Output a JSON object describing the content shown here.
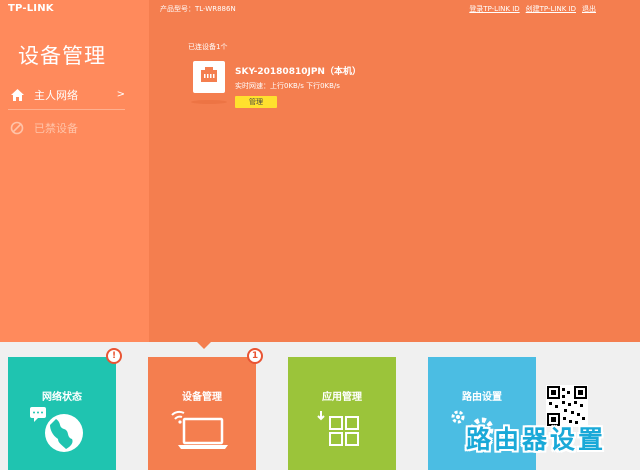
{
  "header": {
    "logo": "TP-LINK",
    "product_label": "产品型号：TL-WR886N",
    "links": [
      "登录TP-LINK ID",
      "创建TP-LINK ID",
      "退出"
    ]
  },
  "sidebar": {
    "title": "设备管理",
    "items": [
      {
        "label": "主人网络",
        "arrow": ">",
        "icon": "home-icon"
      },
      {
        "label": "已禁设备",
        "icon": "blocked-icon"
      }
    ]
  },
  "main": {
    "connected_label": "已连设备1个",
    "device": {
      "name": "SKY-20180810JPN（本机）",
      "speed": "实时网速：上行0KB/s  下行0KB/s",
      "manage_label": "管理",
      "icon": "ethernet-port-icon"
    }
  },
  "tiles": [
    {
      "label": "网络状态",
      "badge": "!",
      "icon": "globe-chat-icon"
    },
    {
      "label": "设备管理",
      "badge": "1",
      "icon": "laptop-wifi-icon"
    },
    {
      "label": "应用管理",
      "icon": "app-grid-icon"
    },
    {
      "label": "路由设置",
      "icon": "gear-icon"
    }
  ],
  "watermark": "路由器设置",
  "colors": {
    "sidebar": "#ff8a5c",
    "main": "#f47e4f",
    "tile_network": "#1fc4b0",
    "tile_devices": "#f47e4f",
    "tile_apps": "#9bc43a",
    "tile_router": "#4bbde3",
    "manage_button": "#ffe12e"
  }
}
